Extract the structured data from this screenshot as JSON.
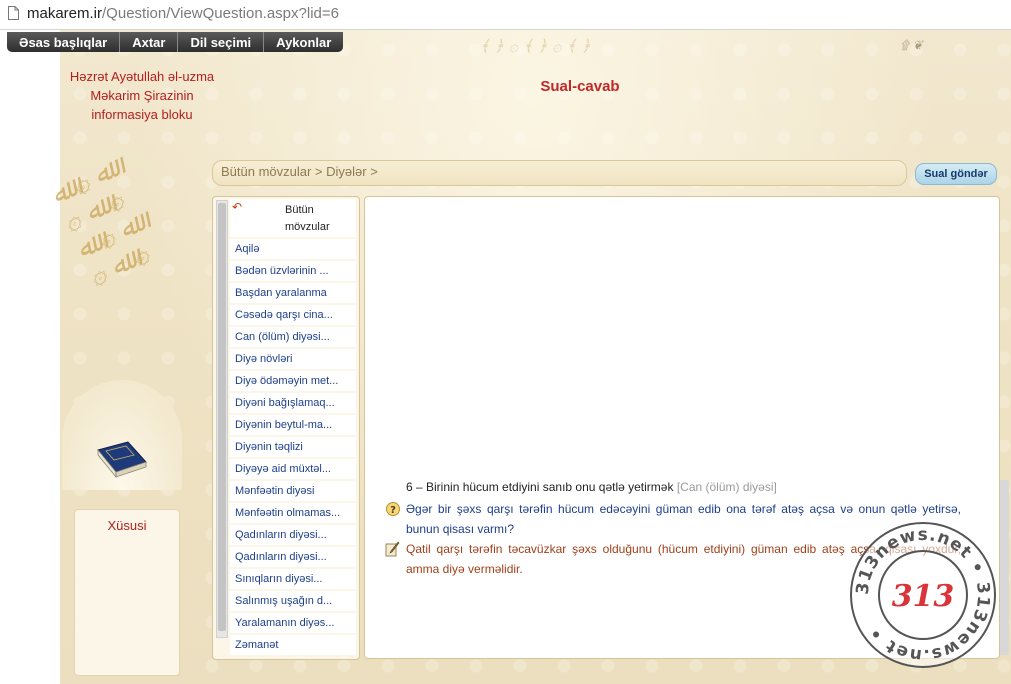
{
  "browser": {
    "url_host": "makarem.ir",
    "url_path": "/Question/ViewQuestion.aspx?lid=6"
  },
  "nav": {
    "items": [
      "Əsas başlıqlar",
      "Axtar",
      "Dil seçimi",
      "Aykonlar"
    ]
  },
  "info_title": {
    "line1": "Həzrət Ayətullah əl-uzma",
    "line2": "Məkarim Şirazinin",
    "line3": "informasiya bloku"
  },
  "header": {
    "title": "Sual-cavab"
  },
  "breadcrumb": "Bütün mövzular > Diyələr >",
  "send_button": "Sual göndər",
  "special": {
    "title": "Xüsusi"
  },
  "topics": {
    "head_line1": "Bütün",
    "head_line2": "mövzular",
    "items": [
      "Aqilə",
      "Bədən üzvlərinin ...",
      "Başdan yaralanma",
      "Cəsədə qarşı cina...",
      "Can (ölüm) diyəsi...",
      "Diyə növləri",
      "Diyə ödəməyin met...",
      "Diyəni bağışlamaq...",
      "Diyənin beytul-ma...",
      "Diyənin təqlizi",
      "Diyəyə aid müxtəl...",
      "Mənfəətin diyəsi",
      "Mənfəətin olmamas...",
      "Qadınların diyəsi...",
      "Qadınların diyəsi...",
      "Sınıqların diyəsi...",
      "Salınmış uşağın d...",
      "Yaralamanın diyəs...",
      "Zəmanət"
    ]
  },
  "question": {
    "title": "6 – Birinin hücum etdiyini sanıb onu qətlə yetirmək",
    "category": "[Can (ölüm) diyəsi]",
    "text": "Əgər bir şəxs qarşı tərəfin hücum edəcəyini güman edib ona tərəf atəş açsa və onun qətlə yetirsə, bunun qisası varmı?",
    "answer": "Qatil qarşı tərəfin təcavüzkar şəxs olduğunu (hücum etdiyini) güman edib atəş açsa, qisası yoxdur, amma diyə verməlidir."
  },
  "watermark": {
    "center": "313",
    "ring": "313news.net • 313news.net •"
  },
  "colors": {
    "accent_red": "#c0282a",
    "link_blue": "#1d3f8a",
    "answer_brown": "#a0401a",
    "parchment": "#efe3c5"
  }
}
